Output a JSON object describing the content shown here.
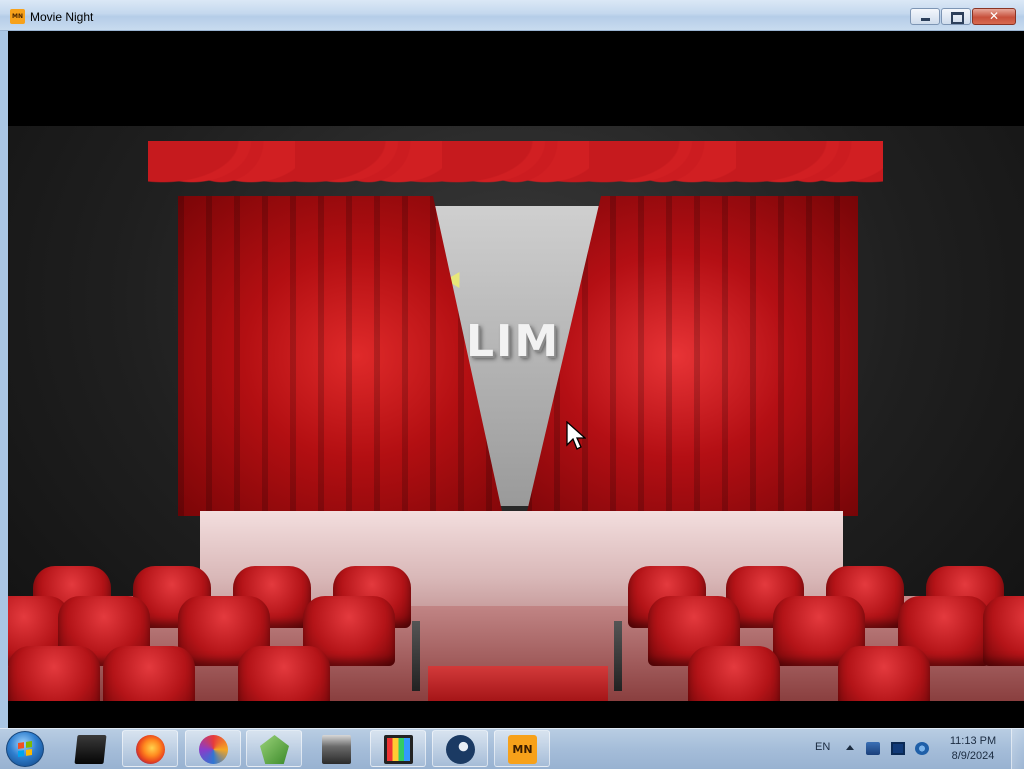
{
  "window": {
    "title": "Movie Night",
    "app_icon_text": "MN",
    "controls": {
      "minimize_icon": "minimize-icon",
      "maximize_icon": "restore-icon",
      "close_glyph": "✕"
    }
  },
  "content": {
    "scene_text": "LIM",
    "cursor_icon": "mouse-pointer-icon"
  },
  "taskbar": {
    "start_icon": "windows-start-orb",
    "apps": [
      {
        "name": "black-box-app-icon"
      },
      {
        "name": "firefox-icon"
      },
      {
        "name": "swirl-app-icon"
      },
      {
        "name": "green-gem-app-icon"
      },
      {
        "name": "game-app-icon"
      },
      {
        "name": "film-app-icon"
      },
      {
        "name": "steam-icon"
      },
      {
        "name": "movie-night-app-icon",
        "label": "MN"
      }
    ],
    "tray": {
      "language": "EN",
      "time": "11:13 PM",
      "date": "8/9/2024"
    }
  },
  "colors": {
    "curtain_red": "#c0151a",
    "taskbar_blue": "#a5bdd9",
    "app_orange": "#f7a11a"
  }
}
